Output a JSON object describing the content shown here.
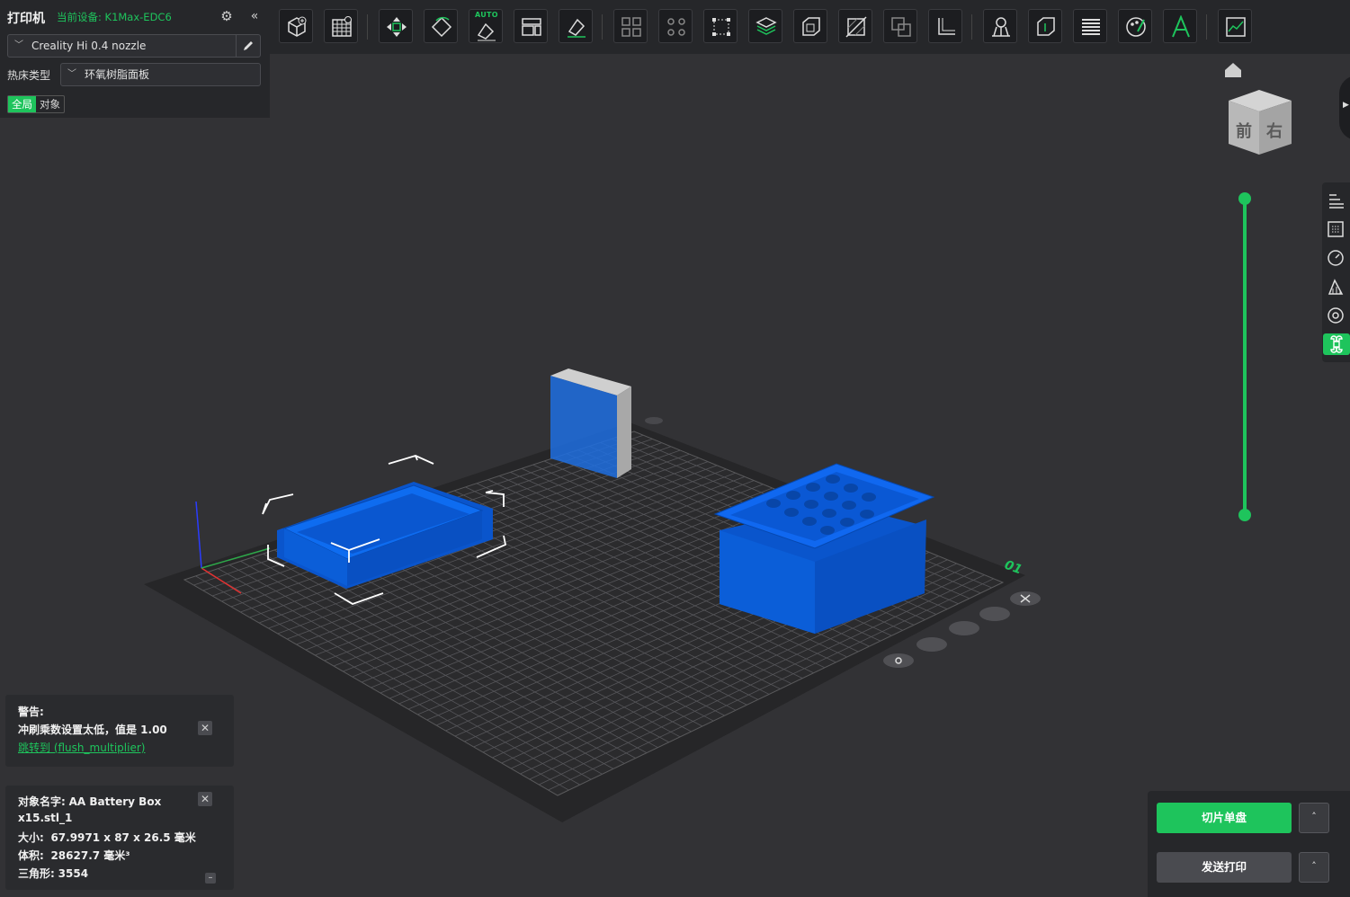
{
  "printer_panel": {
    "title": "打印机",
    "device": "当前设备: K1Max-EDC6",
    "nozzle": "Creality Hi 0.4 nozzle",
    "bed_type_label": "热床类型",
    "bed_type_value": "环氧树脂面板",
    "scope_tabs": [
      "全局",
      "对象"
    ]
  },
  "toolbar": {
    "auto_tag": "AUTO",
    "icons": [
      "add-object-icon",
      "grid-plate-icon",
      "move-icon",
      "rotate-icon",
      "auto-orient-icon",
      "arrange-icon",
      "lay-on-face-icon",
      "split-objects-icon",
      "split-parts-icon",
      "scale-icon",
      "slice-plane-icon",
      "hollow-icon",
      "cut-icon",
      "boolean-icon",
      "measure-icon",
      "support-paint-icon",
      "seam-icon",
      "layer-icon",
      "color-paint-icon",
      "text-icon",
      "assembly-view-icon"
    ]
  },
  "viewport": {
    "cube_faces": [
      "前",
      "右"
    ],
    "plate_label": "01"
  },
  "warning_card": {
    "title": "警告:",
    "message": "冲刷乘数设置太低，值是 1.00",
    "link": "跳转到 (flush_multiplier)"
  },
  "object_card": {
    "name_label": "对象名字:",
    "name_value": "AA Battery Box",
    "name_value2": "x15.stl_1",
    "size_label": "大小:",
    "size_value": "67.9971 x 87 x 26.5 毫米",
    "volume_label": "体积:",
    "volume_value": "28627.7 毫米³",
    "triangles_label": "三角形:",
    "triangles_value": "3554"
  },
  "actions": {
    "slice_label": "切片单盘",
    "send_label": "发送打印",
    "caret": "˄"
  },
  "colors": {
    "accent": "#1ec45c",
    "model_blue": "#0a5fd6",
    "panel": "#26272a",
    "background": "#323235"
  }
}
